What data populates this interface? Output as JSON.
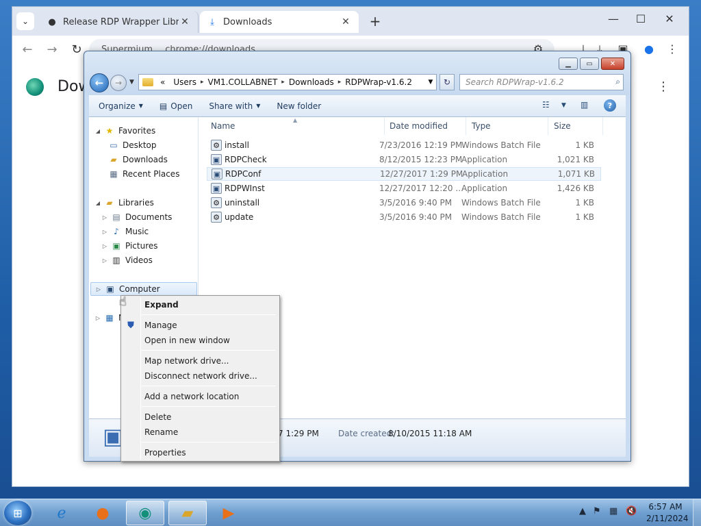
{
  "browser": {
    "tabs": [
      {
        "title": "Release RDP Wrapper Library v",
        "favicon": "github-icon"
      },
      {
        "title": "Downloads",
        "favicon": "download-icon"
      }
    ],
    "address": {
      "site": "Supermium",
      "url": "chrome://downloads"
    },
    "page_title": "Dow"
  },
  "explorer": {
    "breadcrumb": [
      "Users",
      "VM1.COLLABNET",
      "Downloads",
      "RDPWrap-v1.6.2"
    ],
    "breadcrumb_prefix": "«",
    "search_placeholder": "Search RDPWrap-v1.6.2",
    "commands": {
      "organize": "Organize",
      "open": "Open",
      "share_with": "Share with",
      "new_folder": "New folder"
    },
    "nav": {
      "favorites": "Favorites",
      "desktop": "Desktop",
      "downloads": "Downloads",
      "recent_places": "Recent Places",
      "libraries": "Libraries",
      "documents": "Documents",
      "music": "Music",
      "pictures": "Pictures",
      "videos": "Videos",
      "computer": "Computer",
      "network_partial": "N"
    },
    "columns": {
      "name": "Name",
      "date": "Date modified",
      "type": "Type",
      "size": "Size"
    },
    "files": [
      {
        "name": "install",
        "date": "7/23/2016 12:19 PM",
        "type": "Windows Batch File",
        "size": "1 KB"
      },
      {
        "name": "RDPCheck",
        "date": "8/12/2015 12:23 PM",
        "type": "Application",
        "size": "1,021 KB"
      },
      {
        "name": "RDPConf",
        "date": "12/27/2017 1:29 PM",
        "type": "Application",
        "size": "1,071 KB"
      },
      {
        "name": "RDPWInst",
        "date": "12/27/2017 12:20 ...",
        "type": "Application",
        "size": "1,426 KB"
      },
      {
        "name": "uninstall",
        "date": "3/5/2016 9:40 PM",
        "type": "Windows Batch File",
        "size": "1 KB"
      },
      {
        "name": "update",
        "date": "3/5/2016 9:40 PM",
        "type": "Windows Batch File",
        "size": "1 KB"
      }
    ],
    "details": {
      "modified_partial": "7 1:29 PM",
      "created_label": "Date created:",
      "created_value": "8/10/2015 11:18 AM"
    }
  },
  "context_menu": {
    "expand": "Expand",
    "manage": "Manage",
    "open_new_window": "Open in new window",
    "map_drive": "Map network drive...",
    "disconnect_drive": "Disconnect network drive...",
    "add_location": "Add a network location",
    "delete": "Delete",
    "rename": "Rename",
    "properties": "Properties"
  },
  "taskbar": {
    "time": "6:57 AM",
    "date": "2/11/2024"
  },
  "colors": {
    "accent": "#1f5fa8",
    "menu_bg": "#f0f0f0",
    "taskbar": "#6f9fd0"
  }
}
